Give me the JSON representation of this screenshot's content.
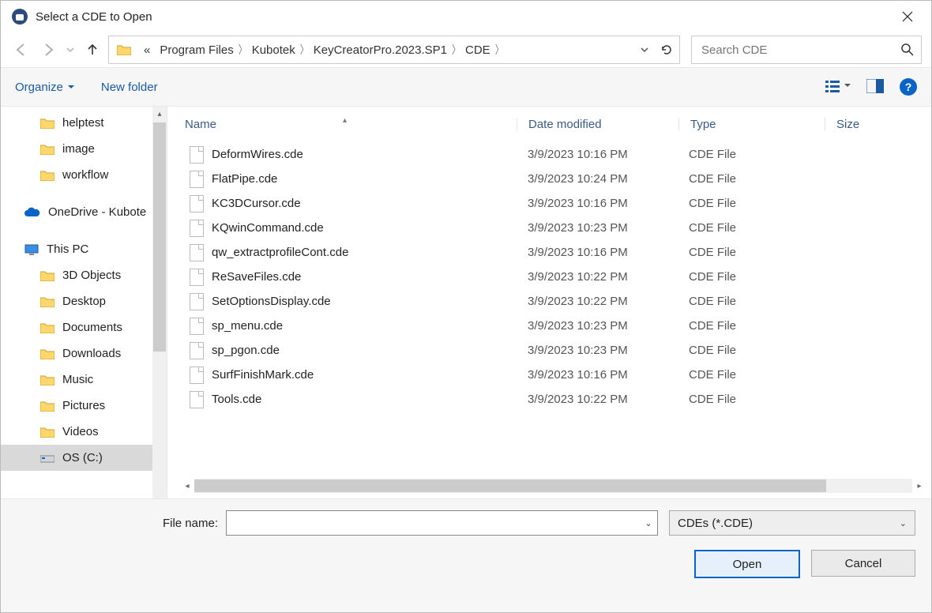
{
  "title": "Select a CDE to Open",
  "breadcrumb": {
    "prefix": "«",
    "items": [
      "Program Files",
      "Kubotek",
      "KeyCreatorPro.2023.SP1",
      "CDE"
    ]
  },
  "search": {
    "placeholder": "Search CDE"
  },
  "toolbar": {
    "organize": "Organize",
    "newfolder": "New folder"
  },
  "columns": {
    "name": "Name",
    "date": "Date modified",
    "type": "Type",
    "size": "Size"
  },
  "tree": {
    "items": [
      {
        "label": "helptest",
        "kind": "folder",
        "indent": "sub"
      },
      {
        "label": "image",
        "kind": "folder",
        "indent": "sub"
      },
      {
        "label": "workflow",
        "kind": "folder",
        "indent": "sub"
      }
    ],
    "cloud": {
      "label": "OneDrive - Kubote"
    },
    "pc_label": "This PC",
    "pc": [
      {
        "label": "3D Objects"
      },
      {
        "label": "Desktop"
      },
      {
        "label": "Documents"
      },
      {
        "label": "Downloads"
      },
      {
        "label": "Music"
      },
      {
        "label": "Pictures"
      },
      {
        "label": "Videos"
      },
      {
        "label": "OS (C:)",
        "selected": true,
        "kind": "drive"
      }
    ]
  },
  "files": [
    {
      "name": "DeformWires.cde",
      "date": "3/9/2023 10:16 PM",
      "type": "CDE File"
    },
    {
      "name": "FlatPipe.cde",
      "date": "3/9/2023 10:24 PM",
      "type": "CDE File"
    },
    {
      "name": "KC3DCursor.cde",
      "date": "3/9/2023 10:16 PM",
      "type": "CDE File"
    },
    {
      "name": "KQwinCommand.cde",
      "date": "3/9/2023 10:23 PM",
      "type": "CDE File"
    },
    {
      "name": "qw_extractprofileCont.cde",
      "date": "3/9/2023 10:16 PM",
      "type": "CDE File"
    },
    {
      "name": "ReSaveFiles.cde",
      "date": "3/9/2023 10:22 PM",
      "type": "CDE File"
    },
    {
      "name": "SetOptionsDisplay.cde",
      "date": "3/9/2023 10:22 PM",
      "type": "CDE File"
    },
    {
      "name": "sp_menu.cde",
      "date": "3/9/2023 10:23 PM",
      "type": "CDE File"
    },
    {
      "name": "sp_pgon.cde",
      "date": "3/9/2023 10:23 PM",
      "type": "CDE File"
    },
    {
      "name": "SurfFinishMark.cde",
      "date": "3/9/2023 10:16 PM",
      "type": "CDE File"
    },
    {
      "name": "Tools.cde",
      "date": "3/9/2023 10:22 PM",
      "type": "CDE File"
    }
  ],
  "filename": {
    "label": "File name:",
    "value": ""
  },
  "filter": {
    "label": "CDEs (*.CDE)"
  },
  "buttons": {
    "open": "Open",
    "cancel": "Cancel"
  }
}
